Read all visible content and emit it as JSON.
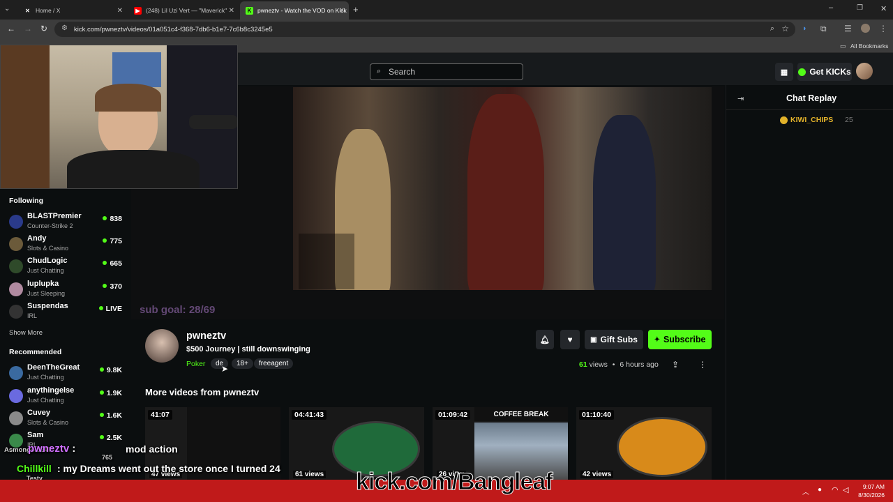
{
  "browser": {
    "tabs": [
      {
        "title": "Home / X",
        "icon": "x-logo-icon"
      },
      {
        "title": "(248) Lil Uzi Vert — \"Maverick\"",
        "icon": "youtube-icon"
      },
      {
        "title": "pwneztv - Watch the VOD on Kick",
        "icon": "kick-icon"
      }
    ],
    "url": "kick.com/pwneztv/videos/01a051c4-f368-7db6-b1e7-7c6b8c3245e5",
    "bookmarks_label": "All Bookmarks"
  },
  "kick": {
    "search_placeholder": "Search",
    "get_kicks_label": "Get KICKs",
    "following_title": "Following",
    "following": [
      {
        "name": "BLASTPremier",
        "category": "Counter-Strike 2",
        "viewers": "838",
        "avatar_color": "#2a3a8a"
      },
      {
        "name": "Andy",
        "category": "Slots & Casino",
        "viewers": "775",
        "avatar_color": "#6b5a3a"
      },
      {
        "name": "ChudLogic",
        "category": "Just Chatting",
        "viewers": "665",
        "avatar_color": "#2f4a2a"
      },
      {
        "name": "luplupka",
        "category": "Just Sleeping",
        "viewers": "370",
        "avatar_color": "#b08aa0"
      },
      {
        "name": "Suspendas",
        "category": "IRL",
        "viewers": "LIVE",
        "avatar_color": "#333333"
      }
    ],
    "show_more": "Show More",
    "recommended_title": "Recommended",
    "recommended": [
      {
        "name": "DeenTheGreat",
        "category": "Just Chatting",
        "viewers": "9.8K",
        "avatar_color": "#3a6aa0"
      },
      {
        "name": "anythingelse",
        "category": "Just Chatting",
        "viewers": "1.9K",
        "avatar_color": "#6a6ae0"
      },
      {
        "name": "Cuvey",
        "category": "Slots & Casino",
        "viewers": "1.6K",
        "avatar_color": "#8a8a8a"
      },
      {
        "name": "Sam",
        "category": "IRL",
        "viewers": "2.5K",
        "avatar_color": "#3a8a4a"
      }
    ],
    "chat_title": "Chat Replay",
    "chat_user": "KIWI_CHIPS",
    "chat_user_count": "25",
    "channel": {
      "name": "pwneztv",
      "title": "$500 Journey | still downswinging",
      "category": "Poker",
      "tags": [
        "de",
        "18+",
        "freeagent"
      ],
      "views": "61",
      "views_label": "views",
      "time_ago": "6 hours ago",
      "gift_subs": "Gift Subs",
      "subscribe": "Subscribe"
    },
    "more_videos_title": "More videos from pwneztv",
    "videos": [
      {
        "duration": "41:07",
        "views": "47 views"
      },
      {
        "duration": "04:41:43",
        "views": "61 views"
      },
      {
        "duration": "01:09:42",
        "views": "26 view",
        "banner": "COFFEE BREAK"
      },
      {
        "duration": "01:10:40",
        "views": "42 views"
      }
    ]
  },
  "overlay": {
    "sub_goal": "sub goal: 28/69",
    "chat_line1_user": "pwneztv",
    "chat_line1_text": "mod action",
    "chat_line1_left": "Asmongold247",
    "chat_line1_count": "765",
    "chat_line2_user": "Chillkill",
    "chat_line2_text": ": my Dreams went out the store once I turned 24",
    "chat_line2_extra": "Testy",
    "watermark": "kick.com/Bangleaf"
  },
  "taskbar": {
    "time": "9:07 AM",
    "date": "8/30/2026"
  },
  "colors": {
    "kick_green": "#53fc18",
    "taskbar": "#c01a1a"
  }
}
